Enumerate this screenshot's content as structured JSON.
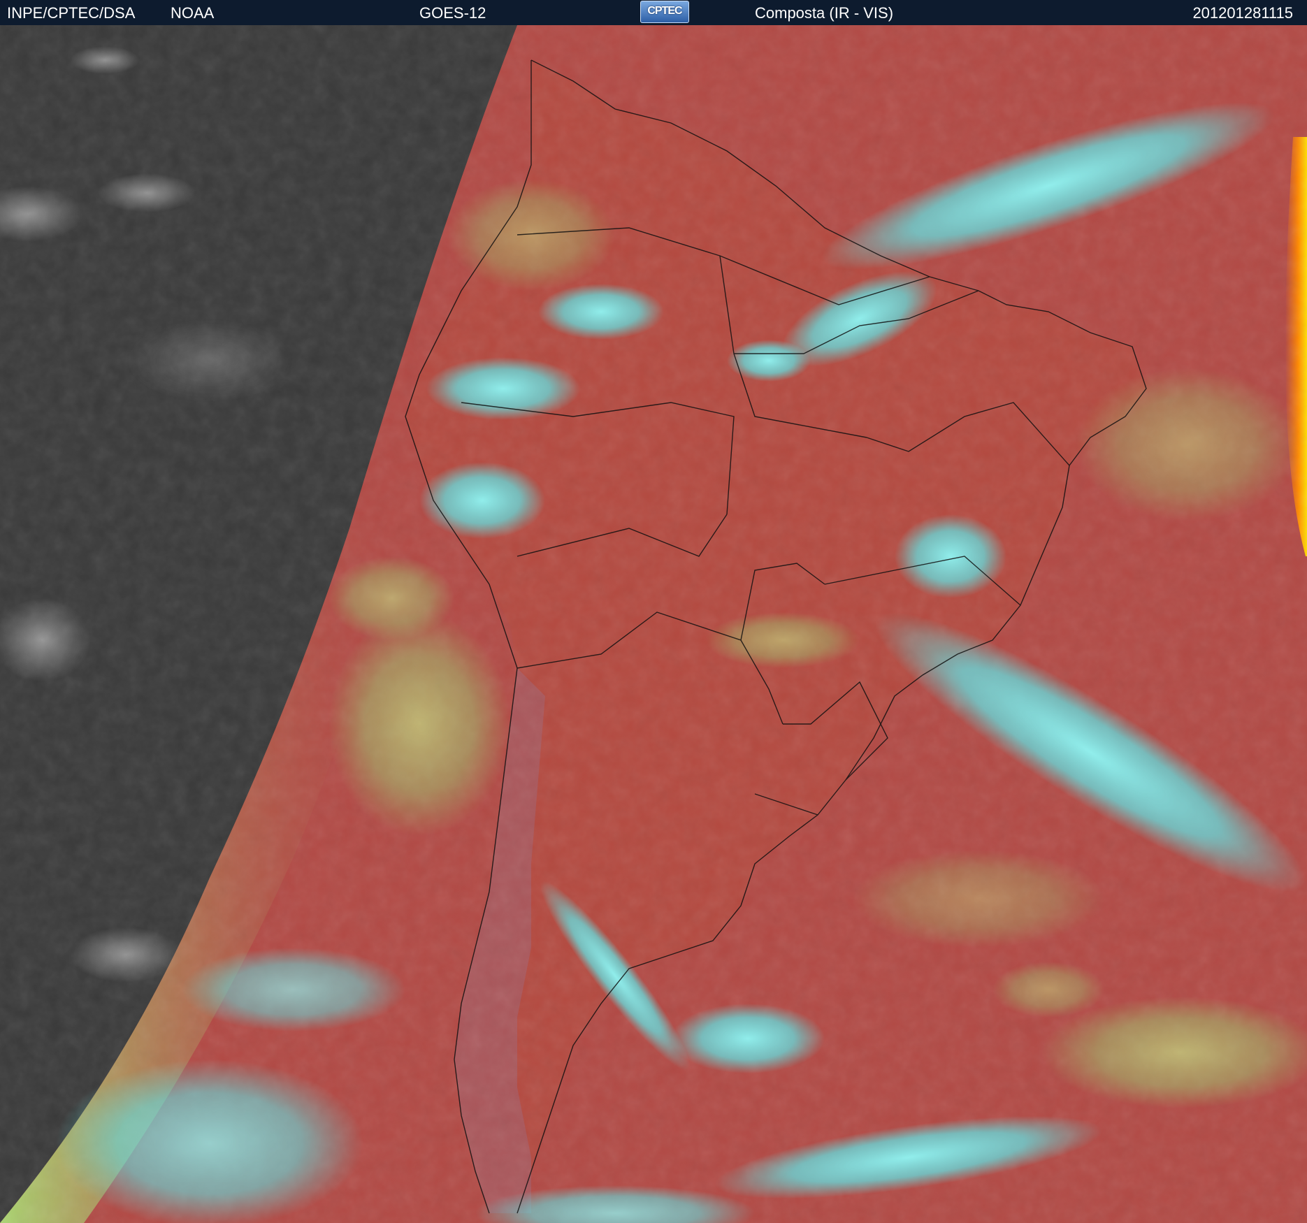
{
  "header": {
    "agency": "INPE/CPTEC/DSA",
    "partner": "NOAA",
    "satellite": "GOES-12",
    "logo_text": "CPTEC",
    "product": "Composta (IR - VIS)",
    "timestamp": "201201281115"
  },
  "colors": {
    "header_bg": "#0d1b2e",
    "night_ir_gray": "#3a3a3a",
    "ocean_red": "#b24a45",
    "land_red": "#b24a42",
    "cold_cloud_cyan": "#5fe8ea",
    "mid_cloud_green": "#9ee07a",
    "limb_orange": "#ff7a00",
    "borders": "#111111"
  },
  "map": {
    "region": "South America",
    "projection": "geostationary full-disk crop",
    "night_side": "west",
    "borders_drawn": true
  }
}
